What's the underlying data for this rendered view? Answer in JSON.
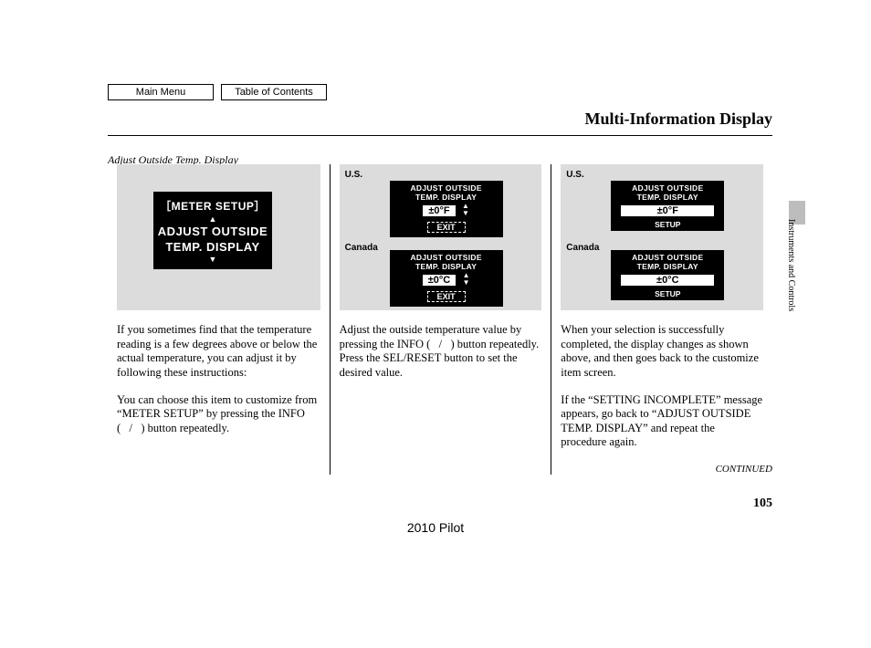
{
  "nav": {
    "main_menu": "Main Menu",
    "toc": "Table of Contents"
  },
  "header": {
    "section_title": "Multi-Information Display",
    "side_label": "Instruments and Controls"
  },
  "subtitle": "Adjust Outside Temp. Display",
  "col1": {
    "lcd": {
      "l1": "［METER SETUP］",
      "l2": "ADJUST OUTSIDE",
      "l3": "TEMP. DISPLAY"
    },
    "p1": "If you sometimes find that the temperature reading is a few degrees above or below the actual temperature, you can adjust it by following these instructions:",
    "p2": "You can choose this item to customize from “METER SETUP” by pressing the INFO (   /   ) button repeatedly."
  },
  "col2": {
    "labels": {
      "us": "U.S.",
      "ca": "Canada"
    },
    "lcd": {
      "t1": "ADJUST OUTSIDE",
      "t2": "TEMP. DISPLAY",
      "val_us": "±0°F",
      "val_ca": "±0°C",
      "exit": "EXIT"
    },
    "p1": "Adjust the outside temperature value by pressing the INFO (   /   ) button repeatedly. Press the SEL/RESET button to set the desired value."
  },
  "col3": {
    "labels": {
      "us": "U.S.",
      "ca": "Canada"
    },
    "lcd": {
      "t1": "ADJUST OUTSIDE",
      "t2": "TEMP. DISPLAY",
      "val_us": "±0°F",
      "val_ca": "±0°C",
      "setup": "SETUP"
    },
    "p1": "When your selection is successfully completed, the display changes as shown above, and then goes back to the customize item screen.",
    "p2": "If the “SETTING INCOMPLETE” message appears, go back to “ADJUST OUTSIDE TEMP. DISPLAY” and repeat the procedure again.",
    "continued": "CONTINUED"
  },
  "footer": {
    "page_num": "105",
    "model": "2010 Pilot"
  },
  "glyphs": {
    "tri_up": "▲",
    "tri_down": "▼"
  }
}
